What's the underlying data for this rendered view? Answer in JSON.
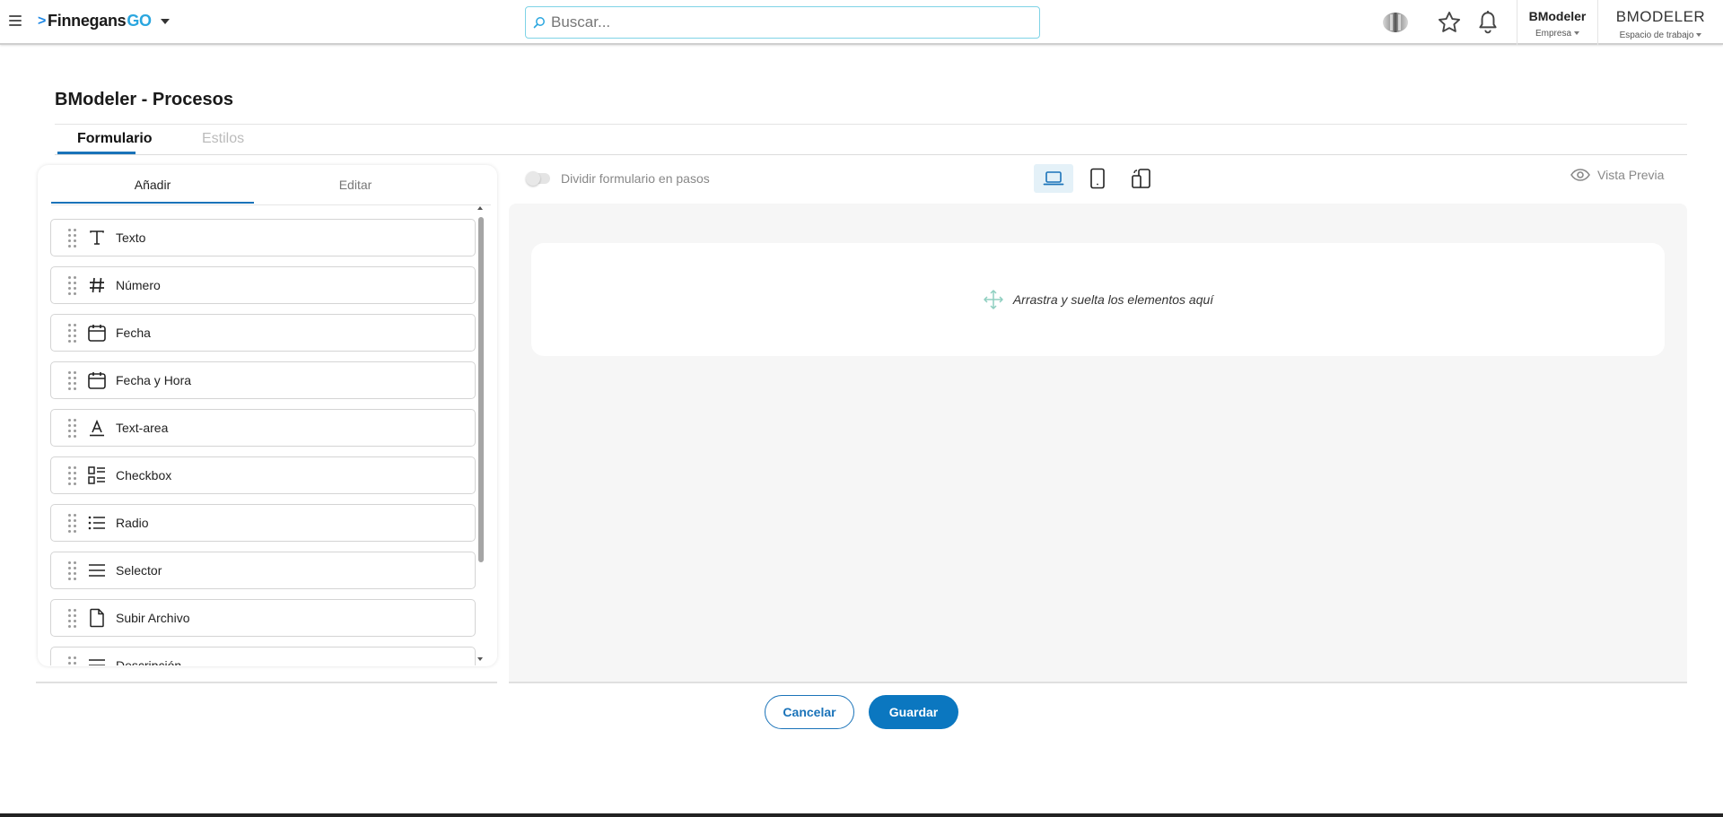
{
  "header": {
    "logo_main": "Finnegans",
    "logo_suffix": "GO",
    "search_placeholder": "Buscar...",
    "company_name": "BModeler",
    "company_label": "Empresa",
    "workspace_name": "BMODELER",
    "workspace_label": "Espacio de trabajo"
  },
  "page": {
    "title": "BModeler - Procesos",
    "tabs": [
      {
        "label": "Formulario",
        "active": true
      },
      {
        "label": "Estilos",
        "active": false
      }
    ]
  },
  "left_panel": {
    "tabs": [
      {
        "label": "Añadir",
        "active": true
      },
      {
        "label": "Editar",
        "active": false
      }
    ],
    "items": [
      {
        "label": "Texto",
        "icon": "text-icon"
      },
      {
        "label": "Número",
        "icon": "hash-icon"
      },
      {
        "label": "Fecha",
        "icon": "calendar-icon"
      },
      {
        "label": "Fecha y Hora",
        "icon": "calendar-icon"
      },
      {
        "label": "Text-area",
        "icon": "text-area-icon"
      },
      {
        "label": "Checkbox",
        "icon": "checkbox-list-icon"
      },
      {
        "label": "Radio",
        "icon": "list-icon"
      },
      {
        "label": "Selector",
        "icon": "menu-lines-icon"
      },
      {
        "label": "Subir Archivo",
        "icon": "file-icon"
      },
      {
        "label": "Descripción",
        "icon": "menu-lines-icon"
      }
    ]
  },
  "editor": {
    "split_steps_label": "Dividir formulario en pasos",
    "split_steps_enabled": false,
    "devices": [
      "laptop-icon",
      "tablet-icon",
      "mobile-rotate-icon"
    ],
    "active_device": "laptop-icon",
    "preview_label": "Vista Previa",
    "dropzone_text": "Arrastra y suelta los elementos aquí"
  },
  "actions": {
    "cancel_label": "Cancelar",
    "save_label": "Guardar"
  },
  "colors": {
    "primary": "#0b77c0",
    "search_border": "#7fd3e6",
    "logo_accent": "#2aa6df",
    "dropzone_icon": "#8fcfc0"
  }
}
